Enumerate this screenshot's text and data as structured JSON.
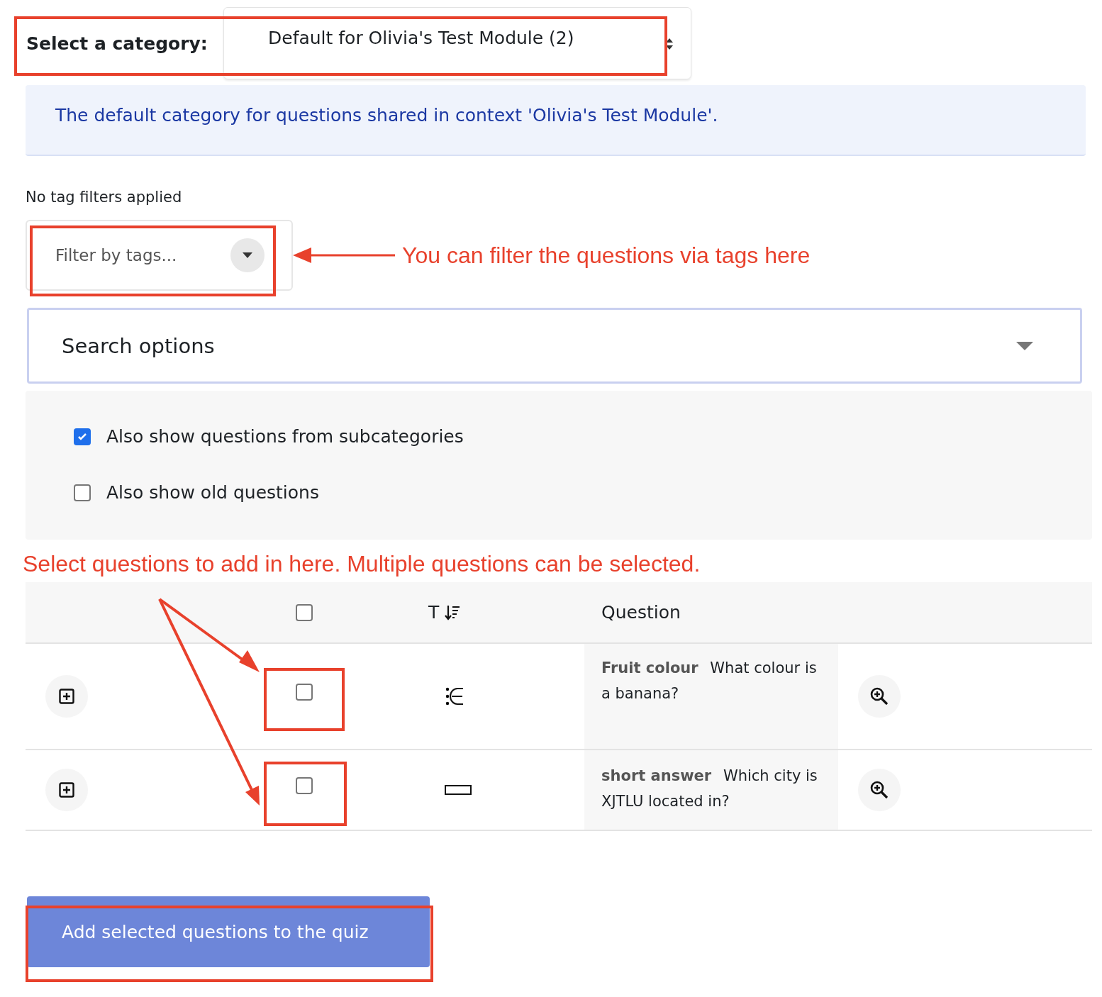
{
  "category_select": {
    "label": "Select a category:",
    "value": "Default for Olivia's Test Module (2)"
  },
  "category_info": "The default category for questions shared in context 'Olivia's Test Module'.",
  "tag_filter_status": "No tag filters applied",
  "tag_filter": {
    "placeholder": "Filter by tags..."
  },
  "tag_callout": "You can filter the questions via tags here",
  "search_options": {
    "title": "Search options"
  },
  "options": [
    {
      "label": "Also show questions from subcategories",
      "checked": true
    },
    {
      "label": "Also show old questions",
      "checked": false
    }
  ],
  "table_callout": "Select questions to add in here. Multiple questions can be selected.",
  "table": {
    "select_all_checked": false,
    "type_header": "T",
    "question_header": "Question",
    "rows": [
      {
        "kind": "multichoice",
        "text": "**Fruit colour**  What colour is a banana?",
        "checked": false
      },
      {
        "kind": "shortanswer",
        "text": "**short answer**  Which city is XJTLU located in?",
        "checked": false
      }
    ]
  },
  "submit_button": "Add selected questions to the quiz"
}
